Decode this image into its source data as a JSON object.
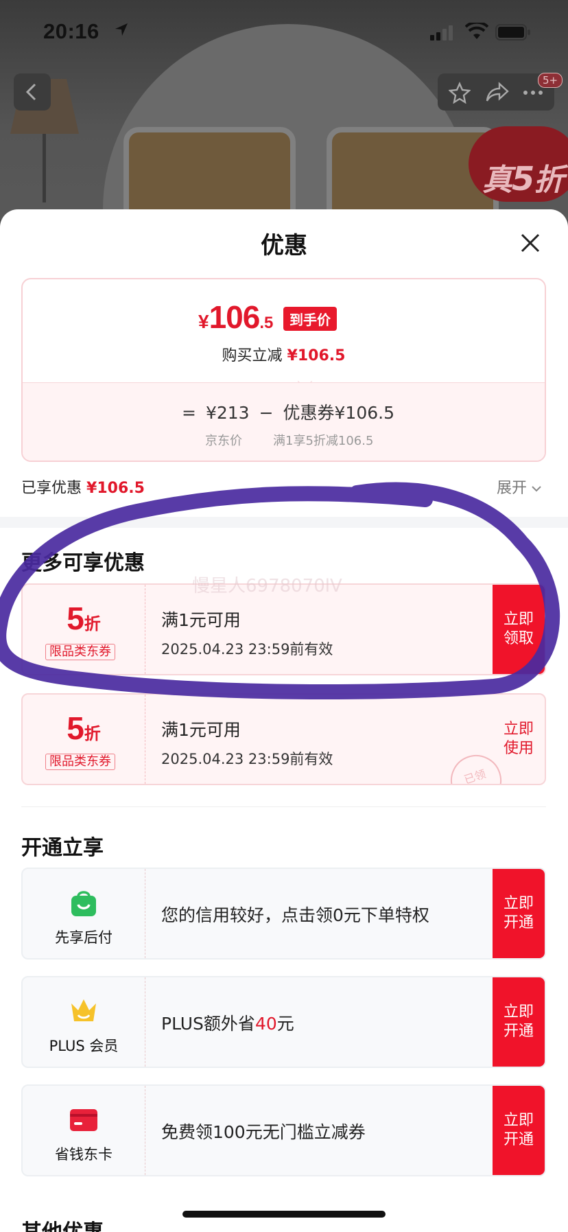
{
  "status_bar": {
    "time": "20:16"
  },
  "header": {
    "more_badge": "5+"
  },
  "background": {
    "badge_text": "真",
    "badge_num": "5",
    "badge_suffix": "折"
  },
  "sheet": {
    "title": "优惠",
    "price": {
      "currency": "¥",
      "integer": "106",
      "decimal": ".5",
      "tag": "到手价",
      "buy_label": "购买立减",
      "buy_amount": "¥106.5",
      "formula_eq": "=",
      "jd_price": "¥213",
      "formula_minus": "−",
      "coupon_label": "优惠券¥106.5",
      "jd_price_label": "京东价",
      "coupon_desc": "满1享5折减106.5"
    },
    "enjoyed_label": "已享优惠",
    "enjoyed_amount": "¥106.5",
    "expand_label": "展开",
    "more_section_title": "更多可享优惠",
    "watermark": "慢星人6978070lV",
    "coupons": [
      {
        "num": "5",
        "unit": "折",
        "tag": "限品类东券",
        "condition": "满1元可用",
        "valid": "2025.04.23 23:59前有效",
        "action": "立即\n领取"
      },
      {
        "num": "5",
        "unit": "折",
        "tag": "限品类东券",
        "condition": "满1元可用",
        "valid": "2025.04.23 23:59前有效",
        "action": "立即\n使用",
        "stamp": "已领"
      }
    ],
    "open_section_title": "开通立享",
    "services": [
      {
        "name": "先享后付",
        "desc": "您的信用较好，点击领0元下单特权",
        "action": "立即\n开通",
        "color": "#2ebd5e"
      },
      {
        "name": "PLUS 会员",
        "desc_pre": "PLUS额外省",
        "desc_num": "40",
        "desc_post": "元",
        "action": "立即\n开通",
        "color": "#f6c22a"
      },
      {
        "name": "省钱东卡",
        "desc": "免费领100元无门槛立减券",
        "action": "立即\n开通",
        "color": "#e8213a"
      }
    ],
    "other_section_title": "其他优惠"
  },
  "colors": {
    "accent": "#e1182b",
    "button": "#f0132a",
    "annotation": "#4a2aa0"
  }
}
